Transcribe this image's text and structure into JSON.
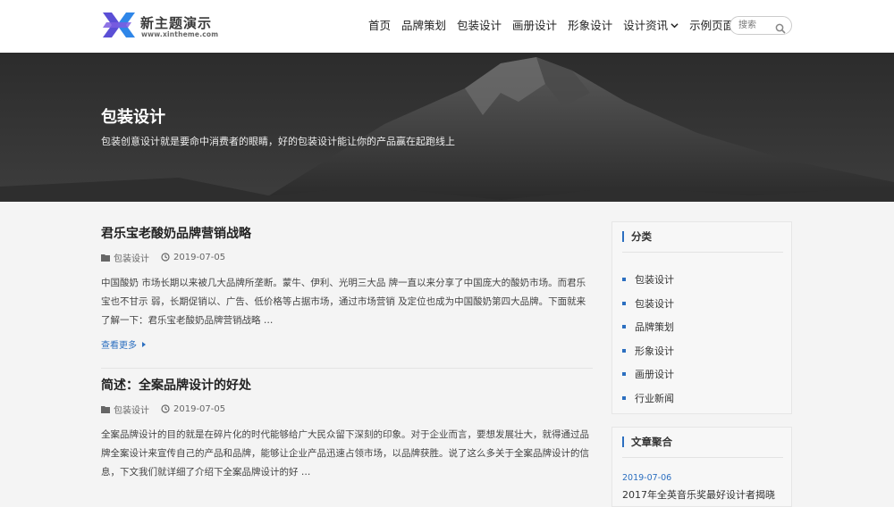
{
  "site": {
    "name": "新主题演示",
    "url_text": "www.xintheme.com"
  },
  "nav": {
    "items": [
      "首页",
      "品牌策划",
      "包装设计",
      "画册设计",
      "形象设计",
      "设计资讯",
      "示例页面"
    ],
    "dropdown_item": "设计资讯"
  },
  "search": {
    "placeholder": "搜索"
  },
  "banner": {
    "title": "包装设计",
    "description": "包装创意设计就是要命中消费者的眼睛，好的包装设计能让你的产品赢在起跑线上"
  },
  "posts": [
    {
      "title": "君乐宝老酸奶品牌营销战略",
      "category": "包装设计",
      "date": "2019-07-05",
      "excerpt": "中国酸奶 市场长期以来被几大品牌所垄断。蒙牛、伊利、光明三大品 牌一直以来分享了中国庞大的酸奶市场。而君乐宝也不甘示  弱，长期促销以、广告、低价格等占据市场，通过市场营销 及定位也成为中国酸奶第四大品牌。下面就来了解一下：君乐宝老酸奶品牌营销战略 …",
      "read_more": "查看更多"
    },
    {
      "title": "简述：全案品牌设计的好处",
      "category": "包装设计",
      "date": "2019-07-05",
      "excerpt": "全案品牌设计的目的就是在碎片化的时代能够给广大民众留下深刻的印象。对于企业而言，要想发展壮大，就得通过品牌全案设计来宣传自己的产品和品牌，能够让企业产品迅速占领市场，以品牌获胜。说了这么多关于全案品牌设计的信息，下文我们就详细了介绍下全案品牌设计的好 …"
    }
  ],
  "sidebar": {
    "categories_title": "分类",
    "categories": [
      "包装设计",
      "包装设计",
      "品牌策划",
      "形象设计",
      "画册设计",
      "行业新闻"
    ],
    "aggregate_title": "文章聚合",
    "aggregate_date": "2019-07-06",
    "aggregate_link": "2017年全英音乐奖最好设计者揭晓"
  },
  "colors": {
    "accent": "#2c6fc0",
    "logo_purple": "#5b4fd6",
    "logo_blue": "#2f86e8"
  }
}
